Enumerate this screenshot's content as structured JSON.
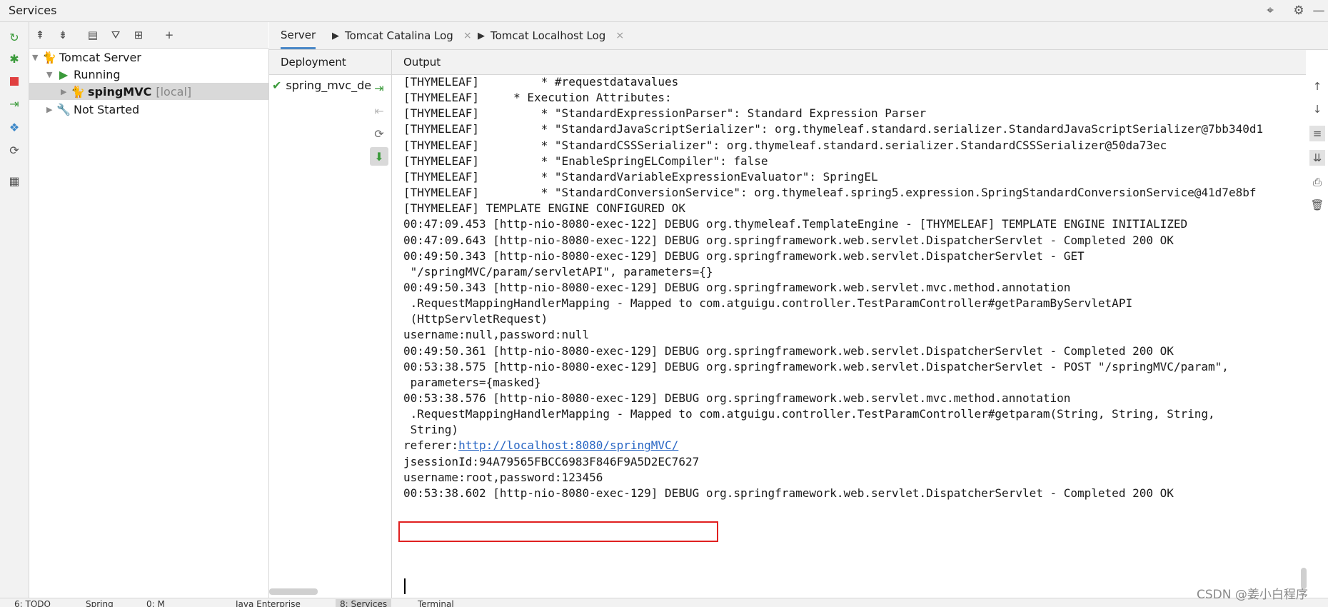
{
  "window": {
    "title": "Services",
    "icons": [
      "crosshair-icon",
      "gear-icon",
      "minimize-icon"
    ]
  },
  "left_strip": {
    "icons": [
      "rerun-icon",
      "debug-icon",
      "stop-icon",
      "deploy-icon",
      "structure-icon",
      "refresh-icon",
      "layout-icon"
    ]
  },
  "tree_toolbar": {
    "icons": [
      "expand-all-icon",
      "collapse-all-icon",
      "group-icon",
      "filter-icon",
      "new-tab-icon",
      "add-icon"
    ]
  },
  "tree": {
    "server_label": "Tomcat Server",
    "running_label": "Running",
    "app_label": "spingMVC",
    "app_suffix": "[local]",
    "not_started_label": "Not Started"
  },
  "tabs": [
    {
      "label": "Server",
      "active": true
    },
    {
      "label": "Tomcat Catalina Log",
      "close": "×"
    },
    {
      "label": "Tomcat Localhost Log",
      "close": "×"
    }
  ],
  "deployment": {
    "header": "Deployment",
    "item": "spring_mvc_de"
  },
  "output": {
    "header": "Output",
    "lines": [
      "[THYMELEAF]         * #requestdatavalues",
      "[THYMELEAF]     * Execution Attributes:",
      "[THYMELEAF]         * \"StandardExpressionParser\": Standard Expression Parser",
      "[THYMELEAF]         * \"StandardJavaScriptSerializer\": org.thymeleaf.standard.serializer.StandardJavaScriptSerializer@7bb340d1",
      "[THYMELEAF]         * \"StandardCSSSerializer\": org.thymeleaf.standard.serializer.StandardCSSSerializer@50da73ec",
      "[THYMELEAF]         * \"EnableSpringELCompiler\": false",
      "[THYMELEAF]         * \"StandardVariableExpressionEvaluator\": SpringEL",
      "[THYMELEAF]         * \"StandardConversionService\": org.thymeleaf.spring5.expression.SpringStandardConversionService@41d7e8bf",
      "[THYMELEAF] TEMPLATE ENGINE CONFIGURED OK",
      "00:47:09.453 [http-nio-8080-exec-122] DEBUG org.thymeleaf.TemplateEngine - [THYMELEAF] TEMPLATE ENGINE INITIALIZED",
      "00:47:09.643 [http-nio-8080-exec-122] DEBUG org.springframework.web.servlet.DispatcherServlet - Completed 200 OK",
      "00:49:50.343 [http-nio-8080-exec-129] DEBUG org.springframework.web.servlet.DispatcherServlet - GET",
      " \"/springMVC/param/servletAPI\", parameters={}",
      "00:49:50.343 [http-nio-8080-exec-129] DEBUG org.springframework.web.servlet.mvc.method.annotation",
      " .RequestMappingHandlerMapping - Mapped to com.atguigu.controller.TestParamController#getParamByServletAPI",
      " (HttpServletRequest)",
      "username:null,password:null",
      "00:49:50.361 [http-nio-8080-exec-129] DEBUG org.springframework.web.servlet.DispatcherServlet - Completed 200 OK",
      "00:53:38.575 [http-nio-8080-exec-129] DEBUG org.springframework.web.servlet.DispatcherServlet - POST \"/springMVC/param\",",
      " parameters={masked}",
      "00:53:38.576 [http-nio-8080-exec-129] DEBUG org.springframework.web.servlet.mvc.method.annotation",
      " .RequestMappingHandlerMapping - Mapped to com.atguigu.controller.TestParamController#getparam(String, String, String,",
      " String)"
    ],
    "referer_prefix": "referer:",
    "referer_link": "http://localhost:8080/springMVC/",
    "jsession_line": "jsessionId:94A79565FBCC6983F846F9A5D2EC7627",
    "after_lines": [
      "username:root,password:123456",
      "00:53:38.602 [http-nio-8080-exec-129] DEBUG org.springframework.web.servlet.DispatcherServlet - Completed 200 OK"
    ],
    "highlight_color": "#e02020",
    "link_color": "#2a67c4"
  },
  "right_strip": {
    "icons": [
      "scroll-up-icon",
      "scroll-down-icon",
      "soft-wrap-icon",
      "scroll-to-end-icon",
      "print-icon",
      "trash-icon"
    ]
  },
  "status_bar": {
    "items": [
      "6: TODO",
      "Spring",
      "0: M",
      "Java Enterprise",
      "8: Services",
      "Terminal"
    ]
  },
  "watermark": "CSDN @姜小白程序"
}
